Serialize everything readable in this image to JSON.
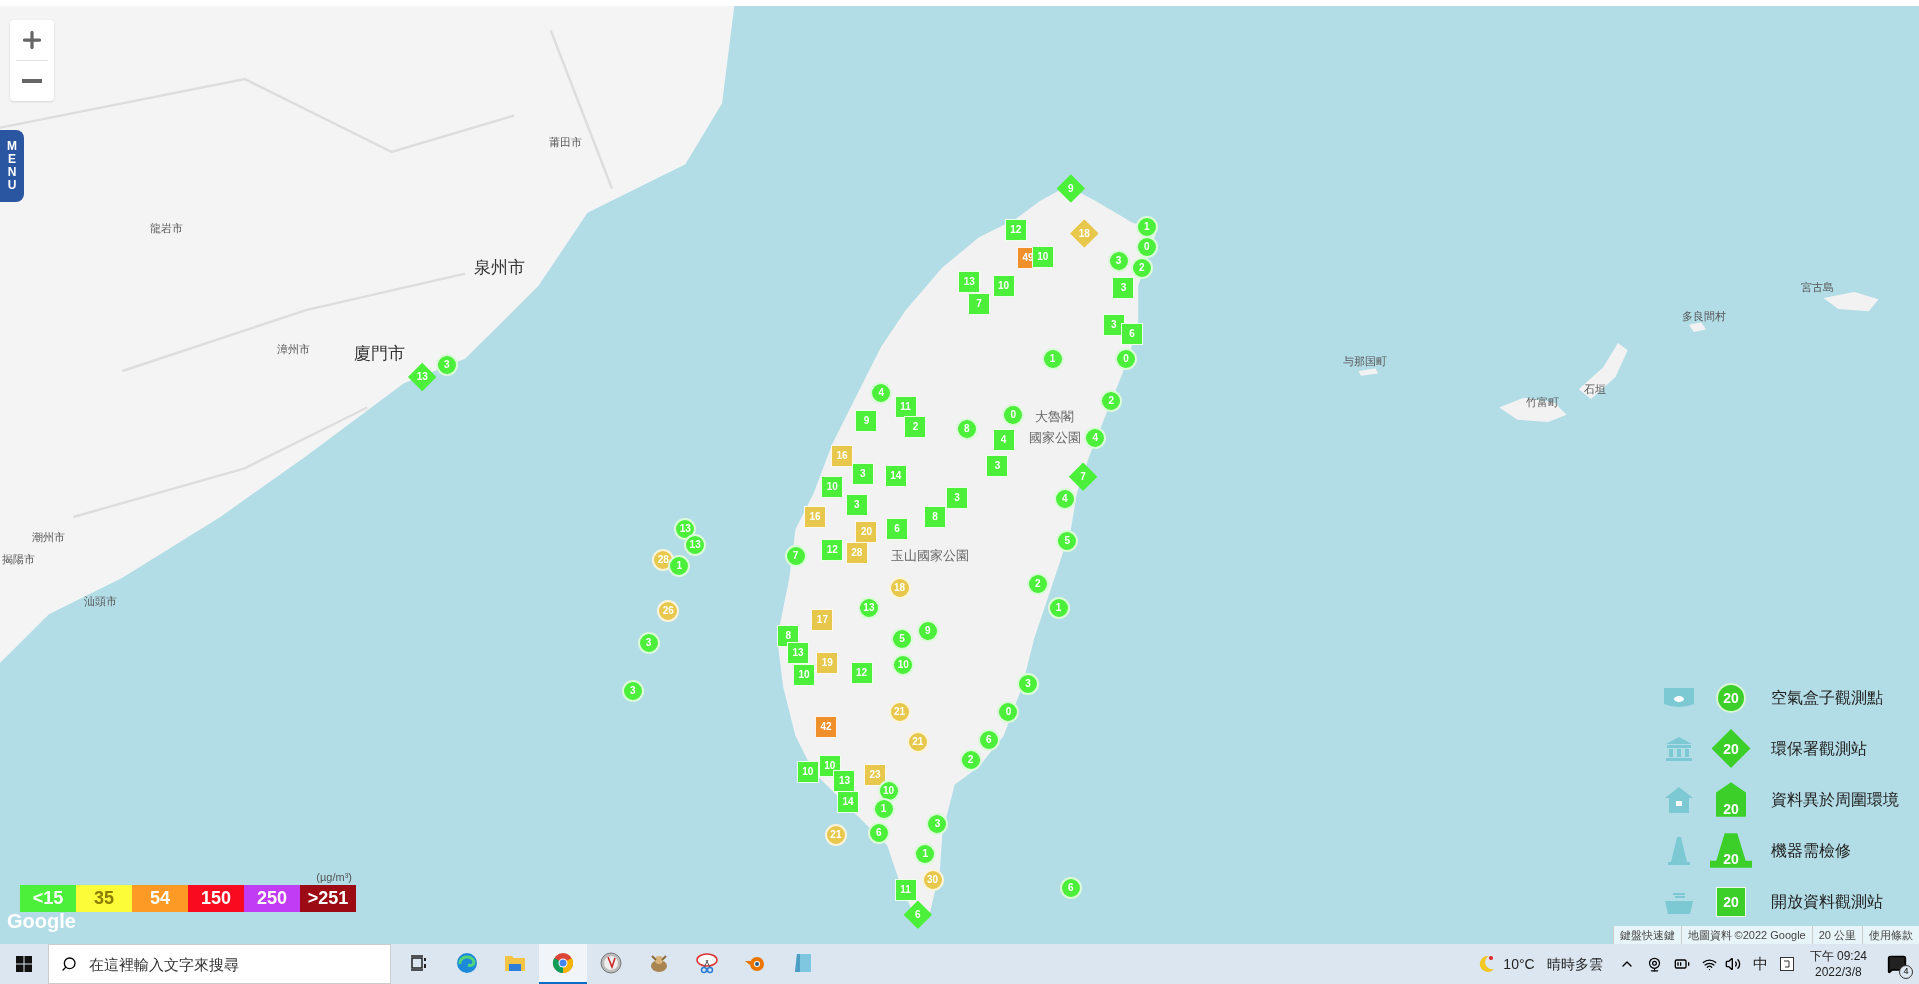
{
  "map_controls": {
    "menu_label": "MENU"
  },
  "map_labels": [
    {
      "text": "莆田市",
      "kind": "city"
    },
    {
      "text": "泉州市",
      "kind": "major"
    },
    {
      "text": "龍岩市",
      "kind": "city"
    },
    {
      "text": "漳州市",
      "kind": "city"
    },
    {
      "text": "廈門市",
      "kind": "major"
    },
    {
      "text": "潮州市",
      "kind": "city"
    },
    {
      "text": "揭陽市",
      "kind": "city"
    },
    {
      "text": "汕頭市",
      "kind": "city"
    },
    {
      "text": "与那国町",
      "kind": "city"
    },
    {
      "text": "竹富町",
      "kind": "city"
    },
    {
      "text": "石垣",
      "kind": "city"
    },
    {
      "text": "宮古島",
      "kind": "city"
    },
    {
      "text": "多良間村",
      "kind": "city"
    },
    {
      "text": "大魯閣",
      "kind": "park"
    },
    {
      "text": "國家公園",
      "kind": "park"
    },
    {
      "text": "玉山國家公園",
      "kind": "park"
    }
  ],
  "markers": [
    {
      "kind": "diamond",
      "value": "9",
      "color": "#4cf03a"
    },
    {
      "kind": "circle",
      "value": "1",
      "color": "#4cf03a"
    },
    {
      "kind": "circle",
      "value": "0",
      "color": "#4cf03a"
    },
    {
      "kind": "circle",
      "value": "2",
      "color": "#4cf03a"
    },
    {
      "kind": "square",
      "value": "12",
      "color": "#4cf03a"
    },
    {
      "kind": "square",
      "value": "49",
      "color": "#f0902a"
    },
    {
      "kind": "diamond",
      "value": "18",
      "color": "#e8c84c"
    },
    {
      "kind": "square",
      "value": "10",
      "color": "#4cf03a"
    },
    {
      "kind": "square",
      "value": "10",
      "color": "#4cf03a"
    },
    {
      "kind": "square",
      "value": "13",
      "color": "#4cf03a"
    },
    {
      "kind": "square",
      "value": "7",
      "color": "#4cf03a"
    },
    {
      "kind": "circle",
      "value": "3",
      "color": "#4cf03a"
    },
    {
      "kind": "square",
      "value": "3",
      "color": "#4cf03a"
    },
    {
      "kind": "square",
      "value": "3",
      "color": "#4cf03a"
    },
    {
      "kind": "square",
      "value": "6",
      "color": "#4cf03a"
    },
    {
      "kind": "circle",
      "value": "1",
      "color": "#4cf03a"
    },
    {
      "kind": "circle",
      "value": "0",
      "color": "#4cf03a"
    },
    {
      "kind": "circle",
      "value": "2",
      "color": "#4cf03a"
    },
    {
      "kind": "circle",
      "value": "0",
      "color": "#4cf03a"
    },
    {
      "kind": "circle",
      "value": "4",
      "color": "#4cf03a"
    },
    {
      "kind": "diamond",
      "value": "7",
      "color": "#4cf03a"
    },
    {
      "kind": "circle",
      "value": "4",
      "color": "#4cf03a"
    },
    {
      "kind": "circle",
      "value": "5",
      "color": "#4cf03a"
    },
    {
      "kind": "circle",
      "value": "2",
      "color": "#4cf03a"
    },
    {
      "kind": "circle",
      "value": "1",
      "color": "#4cf03a"
    },
    {
      "kind": "circle",
      "value": "3",
      "color": "#4cf03a"
    },
    {
      "kind": "circle",
      "value": "0",
      "color": "#4cf03a"
    },
    {
      "kind": "circle",
      "value": "6",
      "color": "#4cf03a"
    },
    {
      "kind": "circle",
      "value": "2",
      "color": "#4cf03a"
    },
    {
      "kind": "circle",
      "value": "3",
      "color": "#4cf03a"
    },
    {
      "kind": "circle",
      "value": "1",
      "color": "#4cf03a"
    },
    {
      "kind": "circle",
      "value": "30",
      "color": "#e8c84c"
    },
    {
      "kind": "square",
      "value": "11",
      "color": "#4cf03a"
    },
    {
      "kind": "diamond",
      "value": "6",
      "color": "#4cf03a"
    },
    {
      "kind": "circle",
      "value": "6",
      "color": "#4cf03a"
    },
    {
      "kind": "square",
      "value": "4",
      "color": "#4cf03a"
    },
    {
      "kind": "square",
      "value": "3",
      "color": "#4cf03a"
    },
    {
      "kind": "square",
      "value": "3",
      "color": "#4cf03a"
    },
    {
      "kind": "square",
      "value": "8",
      "color": "#4cf03a"
    },
    {
      "kind": "square",
      "value": "9",
      "color": "#4cf03a"
    },
    {
      "kind": "square",
      "value": "16",
      "color": "#e8c84c"
    },
    {
      "kind": "square",
      "value": "3",
      "color": "#4cf03a"
    },
    {
      "kind": "square",
      "value": "14",
      "color": "#4cf03a"
    },
    {
      "kind": "circle",
      "value": "4",
      "color": "#4cf03a"
    },
    {
      "kind": "square",
      "value": "11",
      "color": "#4cf03a"
    },
    {
      "kind": "square",
      "value": "2",
      "color": "#4cf03a"
    },
    {
      "kind": "circle",
      "value": "8",
      "color": "#4cf03a"
    },
    {
      "kind": "square",
      "value": "10",
      "color": "#4cf03a"
    },
    {
      "kind": "square",
      "value": "3",
      "color": "#4cf03a"
    },
    {
      "kind": "square",
      "value": "16",
      "color": "#e8c84c"
    },
    {
      "kind": "square",
      "value": "20",
      "color": "#e8c84c"
    },
    {
      "kind": "square",
      "value": "12",
      "color": "#4cf03a"
    },
    {
      "kind": "square",
      "value": "28",
      "color": "#e8c84c"
    },
    {
      "kind": "square",
      "value": "6",
      "color": "#4cf03a"
    },
    {
      "kind": "circle",
      "value": "7",
      "color": "#4cf03a"
    },
    {
      "kind": "circle",
      "value": "18",
      "color": "#e8c84c"
    },
    {
      "kind": "circle",
      "value": "13",
      "color": "#4cf03a"
    },
    {
      "kind": "square",
      "value": "17",
      "color": "#e8c84c"
    },
    {
      "kind": "square",
      "value": "8",
      "color": "#4cf03a"
    },
    {
      "kind": "square",
      "value": "13",
      "color": "#4cf03a"
    },
    {
      "kind": "square",
      "value": "10",
      "color": "#4cf03a"
    },
    {
      "kind": "square",
      "value": "19",
      "color": "#e8c84c"
    },
    {
      "kind": "circle",
      "value": "5",
      "color": "#4cf03a"
    },
    {
      "kind": "circle",
      "value": "9",
      "color": "#4cf03a"
    },
    {
      "kind": "circle",
      "value": "10",
      "color": "#4cf03a"
    },
    {
      "kind": "square",
      "value": "12",
      "color": "#4cf03a"
    },
    {
      "kind": "circle",
      "value": "21",
      "color": "#e8c84c"
    },
    {
      "kind": "circle",
      "value": "21",
      "color": "#e8c84c"
    },
    {
      "kind": "square",
      "value": "42",
      "color": "#f0902a"
    },
    {
      "kind": "square",
      "value": "10",
      "color": "#4cf03a"
    },
    {
      "kind": "square",
      "value": "10",
      "color": "#4cf03a"
    },
    {
      "kind": "square",
      "value": "23",
      "color": "#e8c84c"
    },
    {
      "kind": "circle",
      "value": "10",
      "color": "#4cf03a"
    },
    {
      "kind": "square",
      "value": "14",
      "color": "#4cf03a"
    },
    {
      "kind": "circle",
      "value": "21",
      "color": "#e8c84c"
    },
    {
      "kind": "circle",
      "value": "1",
      "color": "#4cf03a"
    },
    {
      "kind": "circle",
      "value": "6",
      "color": "#4cf03a"
    },
    {
      "kind": "square",
      "value": "13",
      "color": "#4cf03a"
    },
    {
      "kind": "diamond",
      "value": "13",
      "color": "#4cf03a"
    },
    {
      "kind": "circle",
      "value": "3",
      "color": "#4cf03a"
    },
    {
      "kind": "circle",
      "value": "13",
      "color": "#4cf03a"
    },
    {
      "kind": "circle",
      "value": "13",
      "color": "#4cf03a"
    },
    {
      "kind": "circle",
      "value": "28",
      "color": "#e8c84c"
    },
    {
      "kind": "circle",
      "value": "1",
      "color": "#4cf03a"
    },
    {
      "kind": "circle",
      "value": "26",
      "color": "#e8c84c"
    },
    {
      "kind": "circle",
      "value": "3",
      "color": "#4cf03a"
    },
    {
      "kind": "circle",
      "value": "3",
      "color": "#4cf03a"
    }
  ],
  "legend": [
    {
      "kind": "circle",
      "value": "20",
      "label": "空氣盒子觀測點"
    },
    {
      "kind": "diamond",
      "value": "20",
      "label": "環保署觀測站"
    },
    {
      "kind": "house",
      "value": "20",
      "label": "資料異於周圍環境"
    },
    {
      "kind": "cone",
      "value": "20",
      "label": "機器需檢修"
    },
    {
      "kind": "square",
      "value": "20",
      "label": "開放資料觀測站"
    }
  ],
  "scale": {
    "unit": "(µg/m³)",
    "steps": [
      {
        "label": "<15",
        "color": "#4cf03a"
      },
      {
        "label": "35",
        "color": "#fdfc38"
      },
      {
        "label": "54",
        "color": "#fd9a26"
      },
      {
        "label": "150",
        "color": "#fa0a1e"
      },
      {
        "label": "250",
        "color": "#c13cf5"
      },
      {
        "label": ">251",
        "color": "#9c0a13"
      }
    ]
  },
  "google_logo": "Google",
  "attribution": [
    "鍵盤快速鍵",
    "地圖資料 ©2022 Google",
    "20 公里",
    "使用條款"
  ],
  "taskbar": {
    "search_placeholder": "在這裡輸入文字來搜尋",
    "apps": [
      {
        "selected": false
      },
      {
        "selected": false
      },
      {
        "selected": false
      },
      {
        "selected": true
      },
      {
        "selected": false
      },
      {
        "selected": false
      },
      {
        "selected": false
      },
      {
        "selected": false
      },
      {
        "selected": false
      }
    ],
    "temperature": "10°C",
    "weather": "晴時多雲",
    "ime": "中",
    "time": "下午 09:24",
    "date": "2022/3/8",
    "notifications": "4"
  }
}
